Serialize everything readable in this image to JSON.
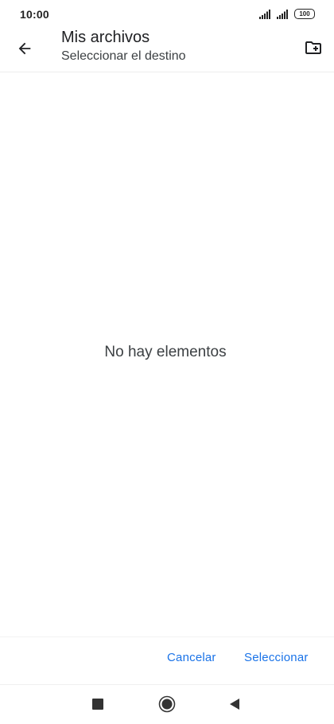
{
  "status_bar": {
    "time": "10:00",
    "battery": "100",
    "icons": [
      "signal-icon",
      "signal-icon",
      "battery-icon"
    ]
  },
  "app_bar": {
    "title": "Mis archivos",
    "subtitle": "Seleccionar el destino",
    "icons": [
      "back-arrow-icon",
      "new-folder-icon"
    ]
  },
  "content": {
    "empty_message": "No hay elementos"
  },
  "actions": {
    "cancel_label": "Cancelar",
    "select_label": "Seleccionar"
  },
  "nav_bar": {
    "icons": [
      "recents-square-icon",
      "home-circle-icon",
      "back-triangle-icon"
    ]
  },
  "colors": {
    "accent": "#1a73e8",
    "text_primary": "#202124",
    "text_secondary": "#3c4043",
    "background": "#ffffff"
  }
}
